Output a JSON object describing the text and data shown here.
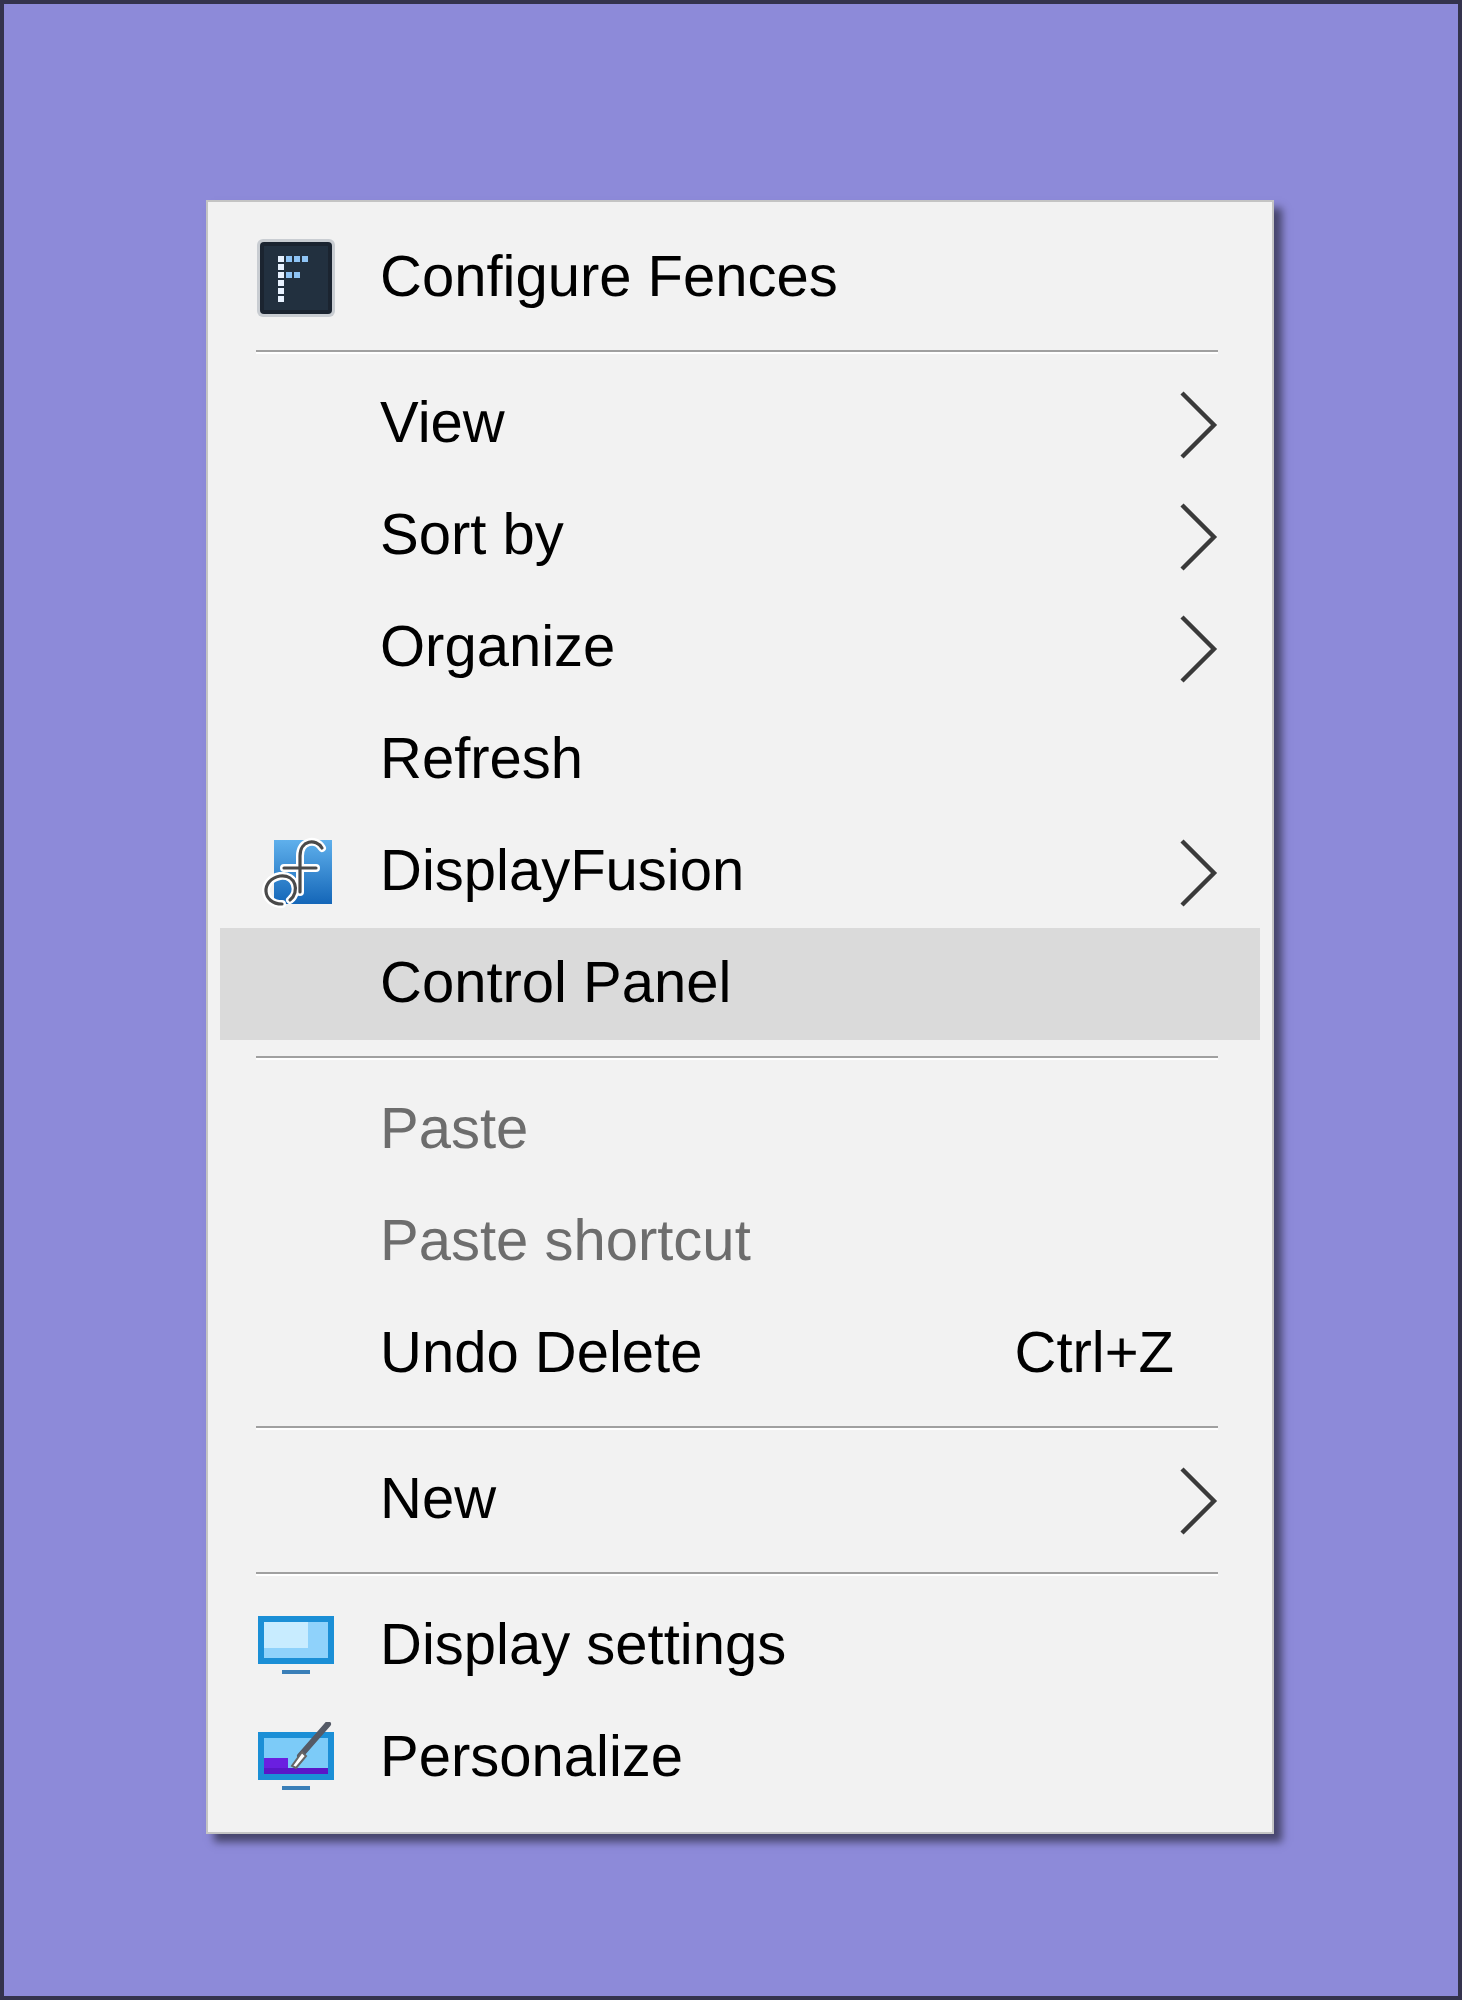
{
  "context_menu": {
    "sections": [
      {
        "items": [
          {
            "label": "Configure Fences",
            "submenu": false,
            "disabled": false,
            "selected": false
          }
        ]
      },
      {
        "items": [
          {
            "label": "View",
            "submenu": true,
            "disabled": false,
            "selected": false
          },
          {
            "label": "Sort by",
            "submenu": true,
            "disabled": false,
            "selected": false
          },
          {
            "label": "Organize",
            "submenu": true,
            "disabled": false,
            "selected": false
          },
          {
            "label": "Refresh",
            "submenu": false,
            "disabled": false,
            "selected": false
          },
          {
            "label": "DisplayFusion",
            "submenu": true,
            "disabled": false,
            "selected": false
          },
          {
            "label": "Control Panel",
            "submenu": false,
            "disabled": false,
            "selected": true
          }
        ]
      },
      {
        "items": [
          {
            "label": "Paste",
            "submenu": false,
            "disabled": true,
            "selected": false
          },
          {
            "label": "Paste shortcut",
            "submenu": false,
            "disabled": true,
            "selected": false
          },
          {
            "label": "Undo Delete",
            "shortcut": "Ctrl+Z",
            "submenu": false,
            "disabled": false,
            "selected": false
          }
        ]
      },
      {
        "items": [
          {
            "label": "New",
            "submenu": true,
            "disabled": false,
            "selected": false
          }
        ]
      },
      {
        "items": [
          {
            "label": "Display settings",
            "submenu": false,
            "disabled": false,
            "selected": false
          },
          {
            "label": "Personalize",
            "submenu": false,
            "disabled": false,
            "selected": false
          }
        ]
      }
    ]
  }
}
